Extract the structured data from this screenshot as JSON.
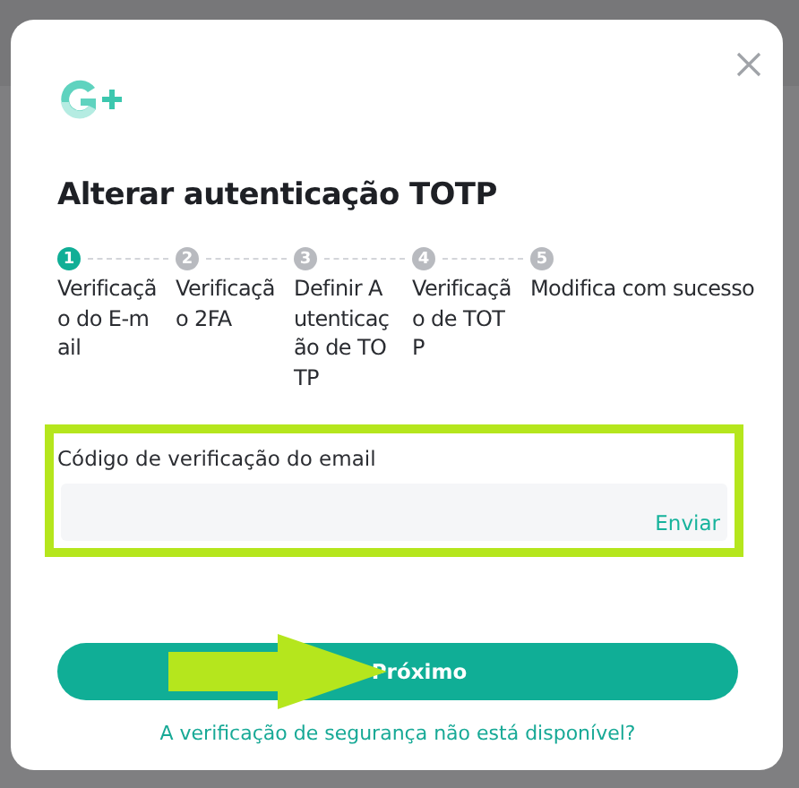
{
  "dialog": {
    "title": "Alterar autenticação TOTP",
    "steps": [
      {
        "number": "1",
        "label": "Verificação do E-mail",
        "selected": true
      },
      {
        "number": "2",
        "label": "Verificação 2FA",
        "selected": false
      },
      {
        "number": "3",
        "label": "Definir Autenticação de TOTP",
        "selected": false
      },
      {
        "number": "4",
        "label": "Verificação de TOTP",
        "selected": false
      },
      {
        "number": "5",
        "label": "Modifica com sucesso",
        "selected": false
      }
    ],
    "field": {
      "label": "Código de verificação do email",
      "action": "Enviar",
      "highlighted": true
    },
    "primary_button": {
      "label": "Próximo",
      "arrow_annotation": true
    },
    "help_link": "A verificação de segurança não está disponível?"
  }
}
